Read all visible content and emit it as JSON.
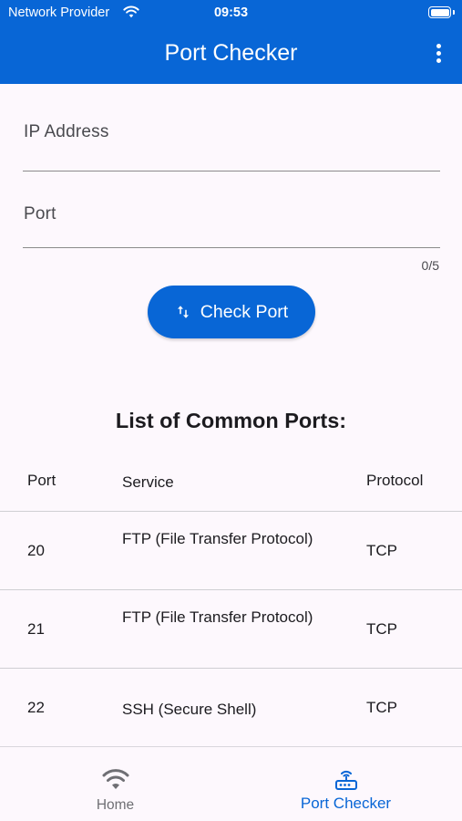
{
  "status_bar": {
    "provider": "Network Provider",
    "time": "09:53",
    "wifi_icon": "wifi-icon",
    "battery_icon": "battery-icon"
  },
  "app_bar": {
    "title": "Port Checker",
    "menu_icon": "more-vert-icon"
  },
  "form": {
    "ip_label": "IP Address",
    "port_label": "Port",
    "port_counter": "0/5",
    "check_button_label": "Check Port",
    "check_button_icon": "swap-vert-icon"
  },
  "ports_list": {
    "title": "List of Common Ports:",
    "headers": [
      "Port",
      "Service",
      "Protocol"
    ],
    "rows": [
      {
        "port": "20",
        "service": "FTP (File Transfer Protocol)",
        "protocol": "TCP"
      },
      {
        "port": "21",
        "service": "FTP (File Transfer Protocol)",
        "protocol": "TCP"
      },
      {
        "port": "22",
        "service": "SSH (Secure Shell)",
        "protocol": "TCP"
      }
    ]
  },
  "bottom_nav": {
    "items": [
      {
        "label": "Home",
        "icon": "wifi-icon",
        "selected": false
      },
      {
        "label": "Port Checker",
        "icon": "router-icon",
        "selected": true
      }
    ]
  },
  "colors": {
    "primary": "#0866d6",
    "background": "#fdf8fd",
    "divider": "#cfcfd3"
  }
}
